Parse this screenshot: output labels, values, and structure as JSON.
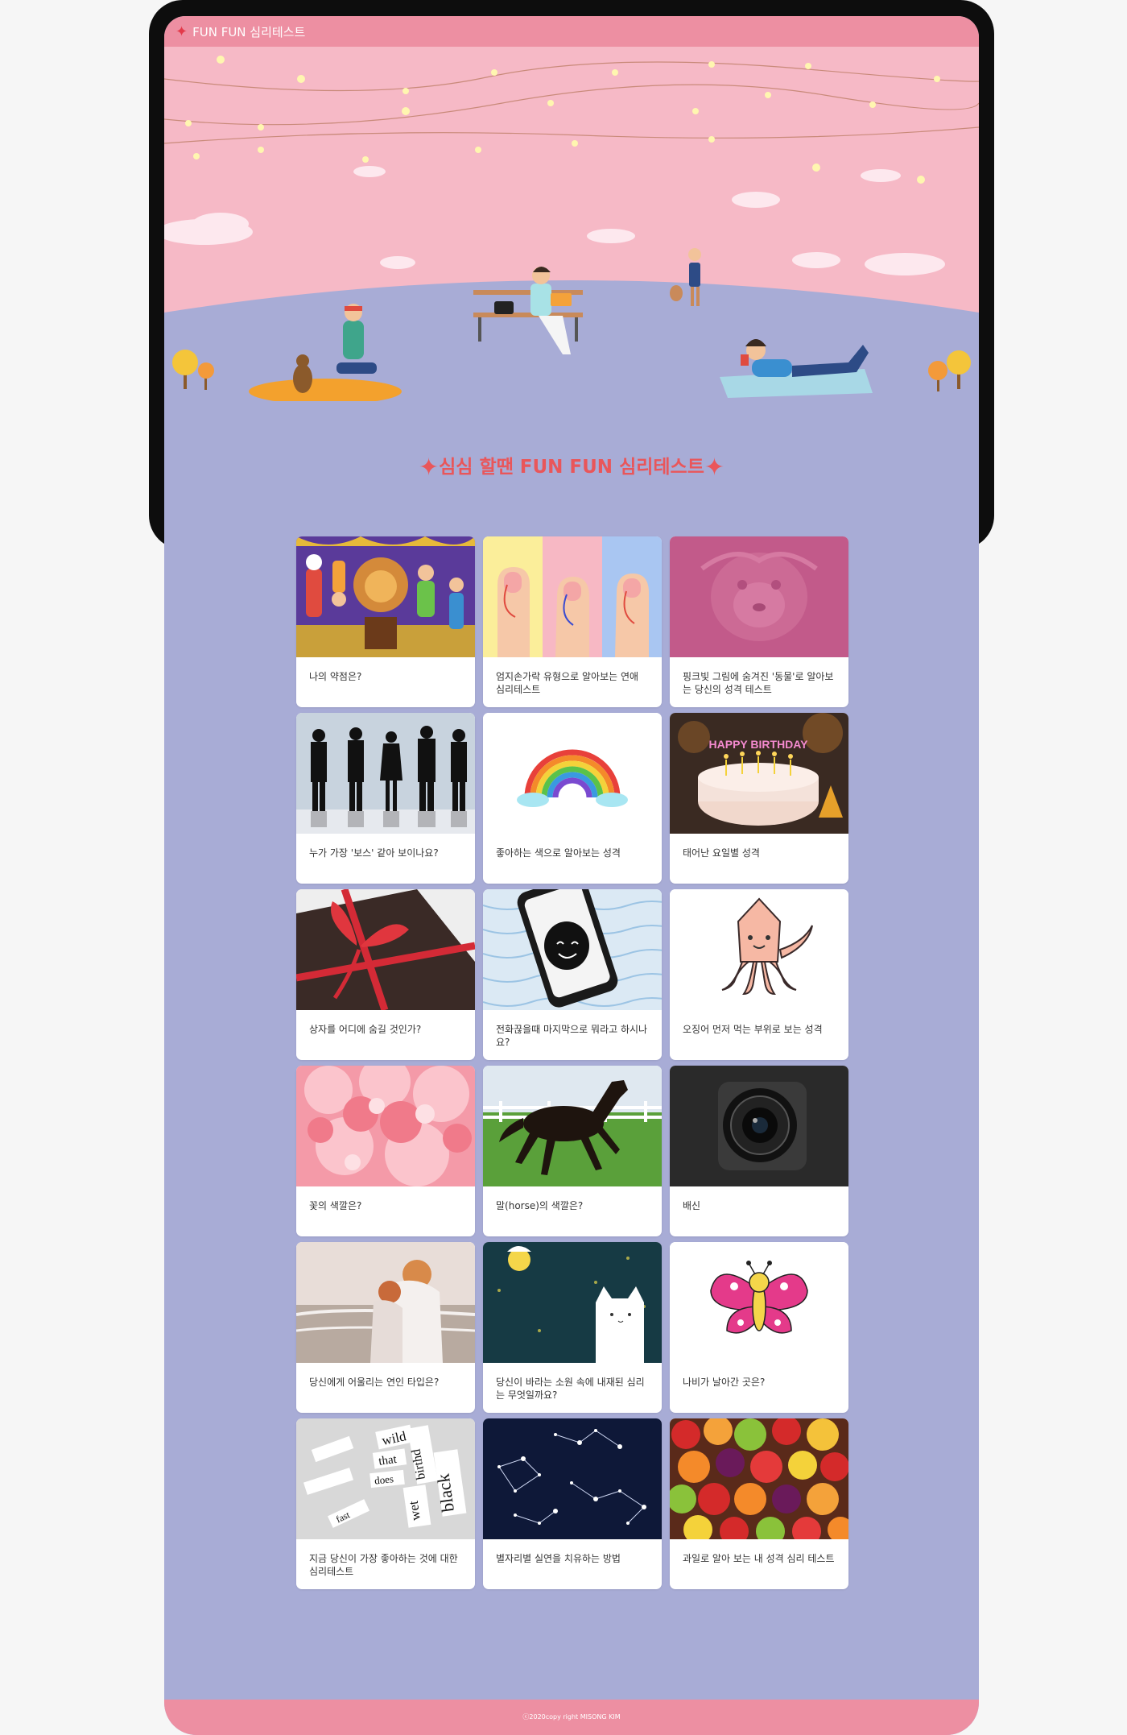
{
  "app_title": "FUN FUN 심리테스트",
  "headline": "심심 할땐 FUN FUN 심리테스트",
  "headline_spark": "✦",
  "brand_colors": {
    "pink_bar": "#ed8fa2",
    "lavender": "#a8acd6",
    "headline": "#e9565a"
  },
  "tests": [
    {
      "title": "나의 약점은?",
      "icon": "circus-illustration"
    },
    {
      "title": "엄지손가락 유형으로 알아보는 연애 심리테스트",
      "icon": "thumbs-illustration"
    },
    {
      "title": "핑크빛 그림에 숨겨진 '동물'로 알아보는 당신의 성격 테스트",
      "icon": "pink-hidden-animal"
    },
    {
      "title": "누가 가장 '보스' 같아 보이나요?",
      "icon": "silhouettes-photo"
    },
    {
      "title": "좋아하는 색으로 알아보는 성격",
      "icon": "rainbow-icon"
    },
    {
      "title": "태어난 요일별 성격",
      "icon": "birthday-cake-photo"
    },
    {
      "title": "상자를 어디에 숨길 것인가?",
      "icon": "gift-box-photo"
    },
    {
      "title": "전화끊을때 마지막으로 뭐라고 하시나요?",
      "icon": "phone-smile-illustration"
    },
    {
      "title": "오징어 먼저 먹는 부위로 보는 성격",
      "icon": "squid-illustration"
    },
    {
      "title": "꽃의 색깔은?",
      "icon": "pink-flower-photo"
    },
    {
      "title": "말(horse)의 색깔은?",
      "icon": "horse-photo"
    },
    {
      "title": "배신",
      "icon": "camera-lens-photo"
    },
    {
      "title": "당신에게 어울리는 연인 타입은?",
      "icon": "couple-photo"
    },
    {
      "title": "당신이 바라는 소원 속에 내재된 심리는 무엇일까요?",
      "icon": "cat-moon-illustration"
    },
    {
      "title": "나비가 날아간 곳은?",
      "icon": "butterfly-illustration"
    },
    {
      "title": "지금 당신이 가장 좋아하는 것에 대한 심리테스트",
      "icon": "word-magnets-photo"
    },
    {
      "title": "별자리별 실연을 치유하는 방법",
      "icon": "constellation-photo"
    },
    {
      "title": "과일로 알아 보는 내 성격 심리 테스트",
      "icon": "fruits-photo"
    }
  ],
  "magnet_words": [
    "wild",
    "that",
    "does",
    "birthd",
    "black",
    "wet",
    "fast"
  ],
  "cake_text": "HAPPY BIRTHDAY",
  "footer": "ⓒ2020copy right MISONG KIM"
}
